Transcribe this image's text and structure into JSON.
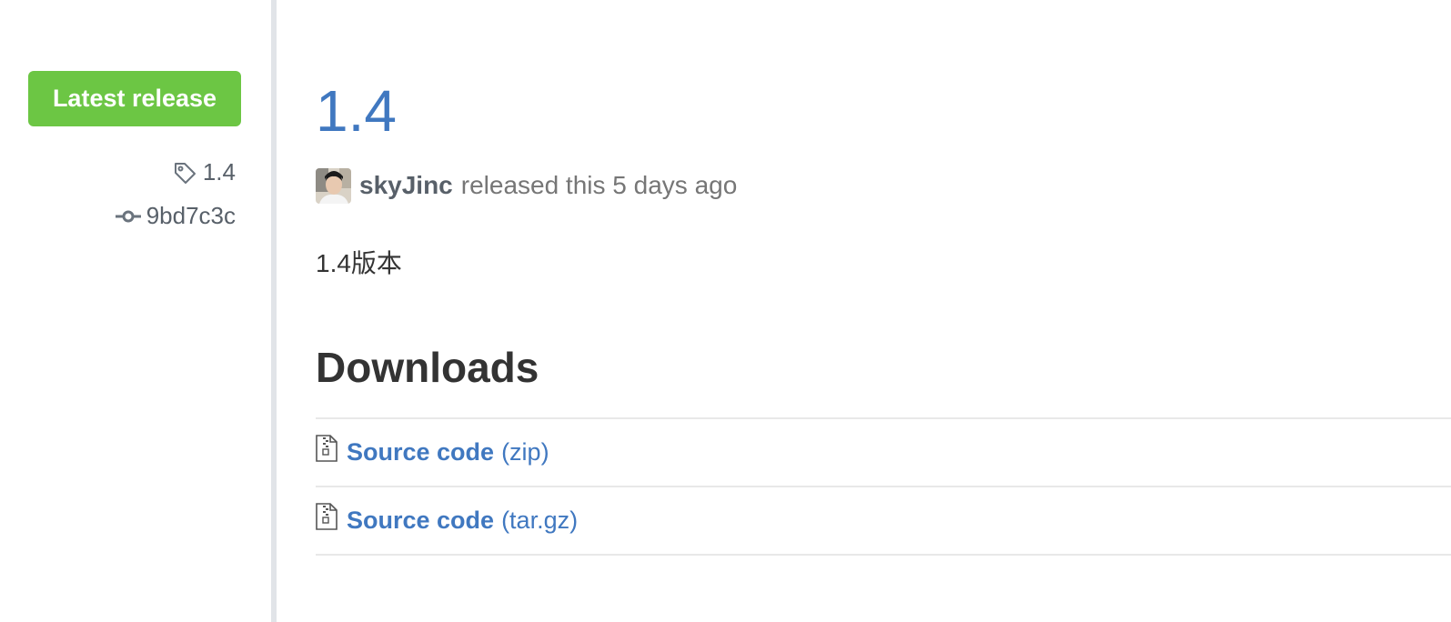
{
  "sidebar": {
    "latest_label": "Latest release",
    "tag": "1.4",
    "commit": "9bd7c3c"
  },
  "release": {
    "title": "1.4",
    "author": "skyJinc",
    "released_text": "released this 5 days ago",
    "notes": "1.4版本"
  },
  "downloads": {
    "heading": "Downloads",
    "items": [
      {
        "name": "Source code",
        "ext": "(zip)"
      },
      {
        "name": "Source code",
        "ext": "(tar.gz)"
      }
    ]
  },
  "colors": {
    "badge_green": "#6cc644",
    "link_blue": "#4078c0",
    "muted": "#586069",
    "divider": "#e8e8e8"
  },
  "icons": [
    "tag-icon",
    "git-commit-icon",
    "file-zip-icon",
    "avatar"
  ]
}
